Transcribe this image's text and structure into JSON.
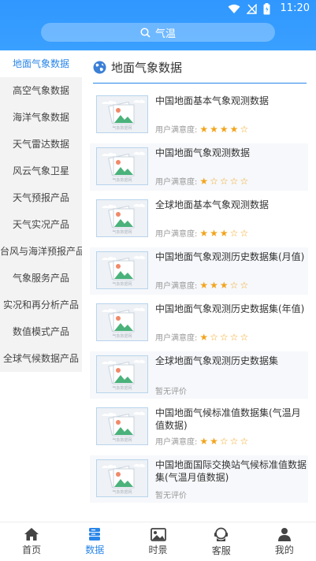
{
  "status": {
    "time": "11:20"
  },
  "search": {
    "text": "气温"
  },
  "sidebar": {
    "items": [
      {
        "label": "地面气象数据",
        "active": true
      },
      {
        "label": "高空气象数据"
      },
      {
        "label": "海洋气象数据"
      },
      {
        "label": "天气雷达数据"
      },
      {
        "label": "风云气象卫星"
      },
      {
        "label": "天气预报产品"
      },
      {
        "label": "天气实况产品"
      },
      {
        "label": "台风与海洋预报产品"
      },
      {
        "label": "气象服务产品"
      },
      {
        "label": "实况和再分析产品"
      },
      {
        "label": "数值模式产品"
      },
      {
        "label": "全球气候数据产品"
      }
    ]
  },
  "main": {
    "section_title": "地面气象数据",
    "rating_label": "用户满意度:",
    "no_rating_text": "暂无评价",
    "thumb_watermark": "气象数据网",
    "items": [
      {
        "title": "中国地面基本气象观测数据",
        "rating": 4
      },
      {
        "title": "中国地面气象观测数据",
        "rating": 1
      },
      {
        "title": "全球地面基本气象观测数据",
        "rating": 3
      },
      {
        "title": "中国地面气象观测历史数据集(月值)",
        "rating": 3
      },
      {
        "title": "中国地面气象观测历史数据集(年值)",
        "rating": 1
      },
      {
        "title": "全球地面气象观测历史数据集",
        "rating": null
      },
      {
        "title": "中国地面气候标准值数据集(气温月值数据)",
        "rating": 2
      },
      {
        "title": "中国地面国际交换站气候标准值数据集(气温月值数据)",
        "rating": null
      }
    ]
  },
  "bottom_nav": {
    "items": [
      {
        "label": "首页",
        "icon": "home-icon"
      },
      {
        "label": "数据",
        "icon": "data-icon",
        "active": true
      },
      {
        "label": "时景",
        "icon": "picture-icon"
      },
      {
        "label": "客服",
        "icon": "service-icon"
      },
      {
        "label": "我的",
        "icon": "user-icon"
      }
    ]
  },
  "colors": {
    "accent": "#2a86e8",
    "header": "#3aa0ff",
    "star": "#f3a41c"
  }
}
